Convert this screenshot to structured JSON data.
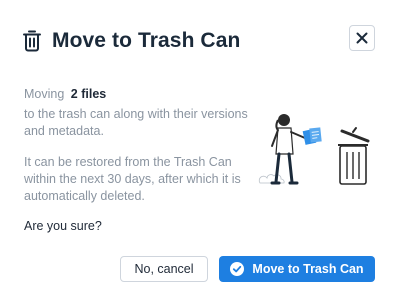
{
  "dialog": {
    "title": "Move to Trash Can",
    "moving_prefix": "Moving",
    "moving_count": "2 files",
    "description": "to the trash can along with their versions and metadata.",
    "restore_note": "It can be restored from the Trash Can within the next 30 days, after which it is automatically deleted.",
    "confirm_question": "Are you sure?",
    "cancel_label": "No, cancel",
    "confirm_label": "Move to Trash Can"
  },
  "icons": {
    "title": "trash-icon",
    "close": "close-icon",
    "confirm": "check-circle-icon"
  },
  "colors": {
    "primary": "#1e7fe1",
    "text": "#1f2937",
    "muted": "#8a94a0",
    "border": "#cfd5dd"
  }
}
